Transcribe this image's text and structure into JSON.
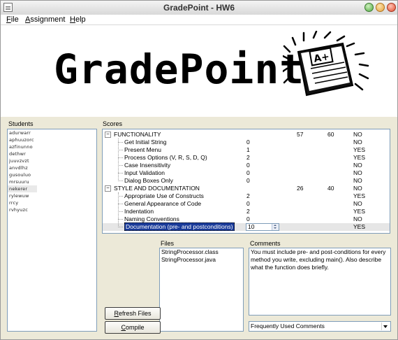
{
  "window": {
    "title": "GradePoint - HW6"
  },
  "menu": [
    {
      "label": "File",
      "underline": "F"
    },
    {
      "label": "Assignment",
      "underline": "A"
    },
    {
      "label": "Help",
      "underline": "H"
    }
  ],
  "logo": {
    "text": "GradePoint",
    "paper_text": "A+"
  },
  "students": {
    "label": "Students",
    "items": [
      "adurwarr",
      "aphuuzorc",
      "azfinunno",
      "dethwr",
      "juuvzvzt",
      "anvdlhz",
      "gusouluo",
      "mrsuuru",
      "nekerer",
      "rylewuw",
      "rrcy",
      "rvhyuzc"
    ],
    "selected_index": 8
  },
  "scores": {
    "label": "Scores",
    "rows": [
      {
        "label": "FUNCTIONALITY",
        "level": 0,
        "expand": "−",
        "value": "",
        "points": "57",
        "max": "60",
        "pass": "NO"
      },
      {
        "label": "Get Initial String",
        "level": 1,
        "value": "0",
        "points": "",
        "max": "",
        "pass": "NO"
      },
      {
        "label": "Present Menu",
        "level": 1,
        "value": "1",
        "points": "",
        "max": "",
        "pass": "YES"
      },
      {
        "label": "Process Options (V, R, S, D, Q)",
        "level": 1,
        "value": "2",
        "points": "",
        "max": "",
        "pass": "YES"
      },
      {
        "label": "Case Insensitivity",
        "level": 1,
        "value": "0",
        "points": "",
        "max": "",
        "pass": "NO"
      },
      {
        "label": "Input Validation",
        "level": 1,
        "value": "0",
        "points": "",
        "max": "",
        "pass": "NO"
      },
      {
        "label": "Dialog Boxes Only",
        "level": 1,
        "value": "0",
        "points": "",
        "max": "",
        "pass": "NO"
      },
      {
        "label": "STYLE AND DOCUMENTATION",
        "level": 0,
        "expand": "−",
        "value": "",
        "points": "26",
        "max": "40",
        "pass": "NO"
      },
      {
        "label": "Appropriate Use of Constructs",
        "level": 1,
        "value": "2",
        "points": "",
        "max": "",
        "pass": "YES"
      },
      {
        "label": "General Appearance of Code",
        "level": 1,
        "value": "0",
        "points": "",
        "max": "",
        "pass": "NO"
      },
      {
        "label": "Indentation",
        "level": 1,
        "value": "2",
        "points": "",
        "max": "",
        "pass": "YES"
      },
      {
        "label": "Naming Conventions",
        "level": 1,
        "value": "0",
        "points": "",
        "max": "",
        "pass": "NO"
      },
      {
        "label": "Documentation (pre- and postconditions)",
        "level": 1,
        "value": "10",
        "points": "",
        "max": "",
        "pass": "YES",
        "editing": true
      }
    ]
  },
  "files": {
    "label": "Files",
    "items": [
      "StringProcessor.class",
      "StringProcessor.java"
    ]
  },
  "comments": {
    "label": "Comments",
    "text": "You must include pre- and post-conditions for every method you write, excluding main().  Also describe what the function does briefly.",
    "dropdown_value": "Frequently Used Comments"
  },
  "buttons": {
    "refresh_label": "Refresh Files",
    "refresh_mnemonic": "R",
    "compile_label": "Compile",
    "compile_mnemonic": "C"
  }
}
